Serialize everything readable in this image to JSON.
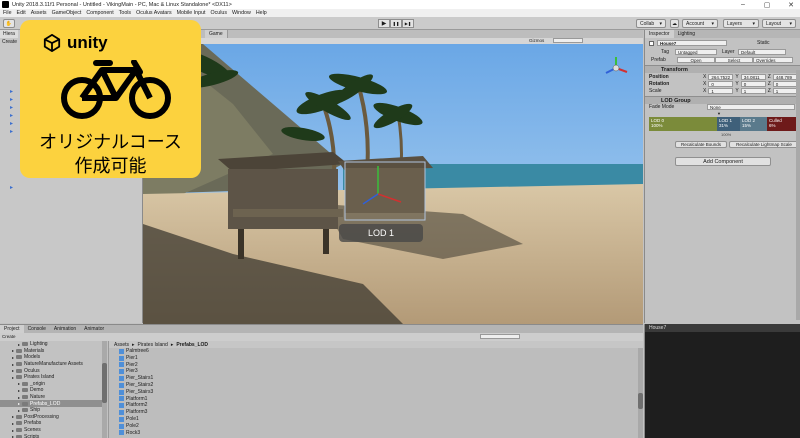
{
  "window": {
    "title": "Unity 2018.3.11f1 Personal - Untitled - VikingMain - PC, Mac & Linux Standalone* <DX11>",
    "controls": [
      "–",
      "▢",
      "✕"
    ]
  },
  "menu": [
    "File",
    "Edit",
    "Assets",
    "GameObject",
    "Component",
    "Tools",
    "Oculus Avatars",
    "Mobile Input",
    "Oculus",
    "Window",
    "Help"
  ],
  "toolbar": {
    "play": "▶",
    "pause": "❚❚",
    "step": "▶❚",
    "collab": "Collab",
    "account": "Account",
    "layers": "Layers",
    "layout": "Layout"
  },
  "promo": {
    "brand": "unity",
    "caption_line1": "オリジナルコース",
    "caption_line2": "作成可能",
    "colors": {
      "background": "#fcd23e",
      "ink": "#000000"
    }
  },
  "hierarchy": {
    "tab": "Hiera",
    "create": "Create"
  },
  "scene": {
    "tabs": {
      "scene": "Scene",
      "game": "Game"
    },
    "gizmos": "Gizmos",
    "search": "All",
    "lod_label": "LOD 1"
  },
  "inspector": {
    "tabs": {
      "inspector": "Inspector",
      "lighting": "Lighting"
    },
    "object_name": "House7",
    "static_label": "Static",
    "tag_label": "Tag",
    "tag_value": "Untagged",
    "layer_label": "Layer",
    "layer_value": "Default",
    "prefab_label": "Prefab",
    "prefab_open": "Open",
    "prefab_select": "Select",
    "prefab_overrides": "Overrides",
    "transform": {
      "header": "Transform",
      "position_label": "Position",
      "pos_x": "264.7522",
      "pos_y": "34.0811",
      "pos_z": "448.789",
      "rotation_label": "Rotation",
      "rot_x": "0",
      "rot_y": "0",
      "rot_z": "0",
      "scale_label": "Scale",
      "scale_x": "1",
      "scale_y": "1",
      "scale_z": "1"
    },
    "lod_group": {
      "header": "LOD Group",
      "fade_label": "Fade Mode",
      "fade_value": "None",
      "marker": "100%",
      "segments": [
        {
          "name": "LOD 0",
          "pct": "100%",
          "color": "#7b8b3a"
        },
        {
          "name": "LOD 1",
          "pct": "31%",
          "color": "#3f607a"
        },
        {
          "name": "LOD 2",
          "pct": "15%",
          "color": "#5a7a8c"
        },
        {
          "name": "Culled",
          "pct": "6%",
          "color": "#6e1a1a"
        }
      ],
      "recalc_bounds": "Recalculate Bounds",
      "recalc_lightmap": "Recalculate Lightmap Scale"
    },
    "add_component": "Add Component"
  },
  "bottom": {
    "tabs": {
      "project": "Project",
      "console": "Console",
      "animation": "Animation",
      "animator": "Animator"
    },
    "create": "Create",
    "folders": [
      {
        "label": "Lighting",
        "indent": 2
      },
      {
        "label": "Materials",
        "indent": 1
      },
      {
        "label": "Models",
        "indent": 1
      },
      {
        "label": "NatureManufacture Assets",
        "indent": 1
      },
      {
        "label": "Oculus",
        "indent": 1
      },
      {
        "label": "Pirates Island",
        "indent": 1
      },
      {
        "label": "_origin",
        "indent": 2
      },
      {
        "label": "Demo",
        "indent": 2
      },
      {
        "label": "Nature",
        "indent": 2
      },
      {
        "label": "Prefabs_LOD",
        "indent": 2
      },
      {
        "label": "Ship",
        "indent": 2
      },
      {
        "label": "PostProcessing",
        "indent": 1
      },
      {
        "label": "Prefabs",
        "indent": 1
      },
      {
        "label": "Scenes",
        "indent": 1
      },
      {
        "label": "Scripts",
        "indent": 1
      }
    ],
    "selected_folder": "Prefabs_LOD",
    "breadcrumb": {
      "a": "Assets",
      "b": "Pirates Island",
      "c": "Prefabs_LOD",
      "sep": "▸"
    },
    "files": [
      "Palmtree6",
      "Pier1",
      "Pier2",
      "Pier3",
      "Pier_Stairs1",
      "Pier_Stairs2",
      "Pier_Stairs3",
      "Platform1",
      "Platform2",
      "Platform3",
      "Pole1",
      "Pole2",
      "Rock3"
    ]
  },
  "console": {
    "header": "House7"
  }
}
